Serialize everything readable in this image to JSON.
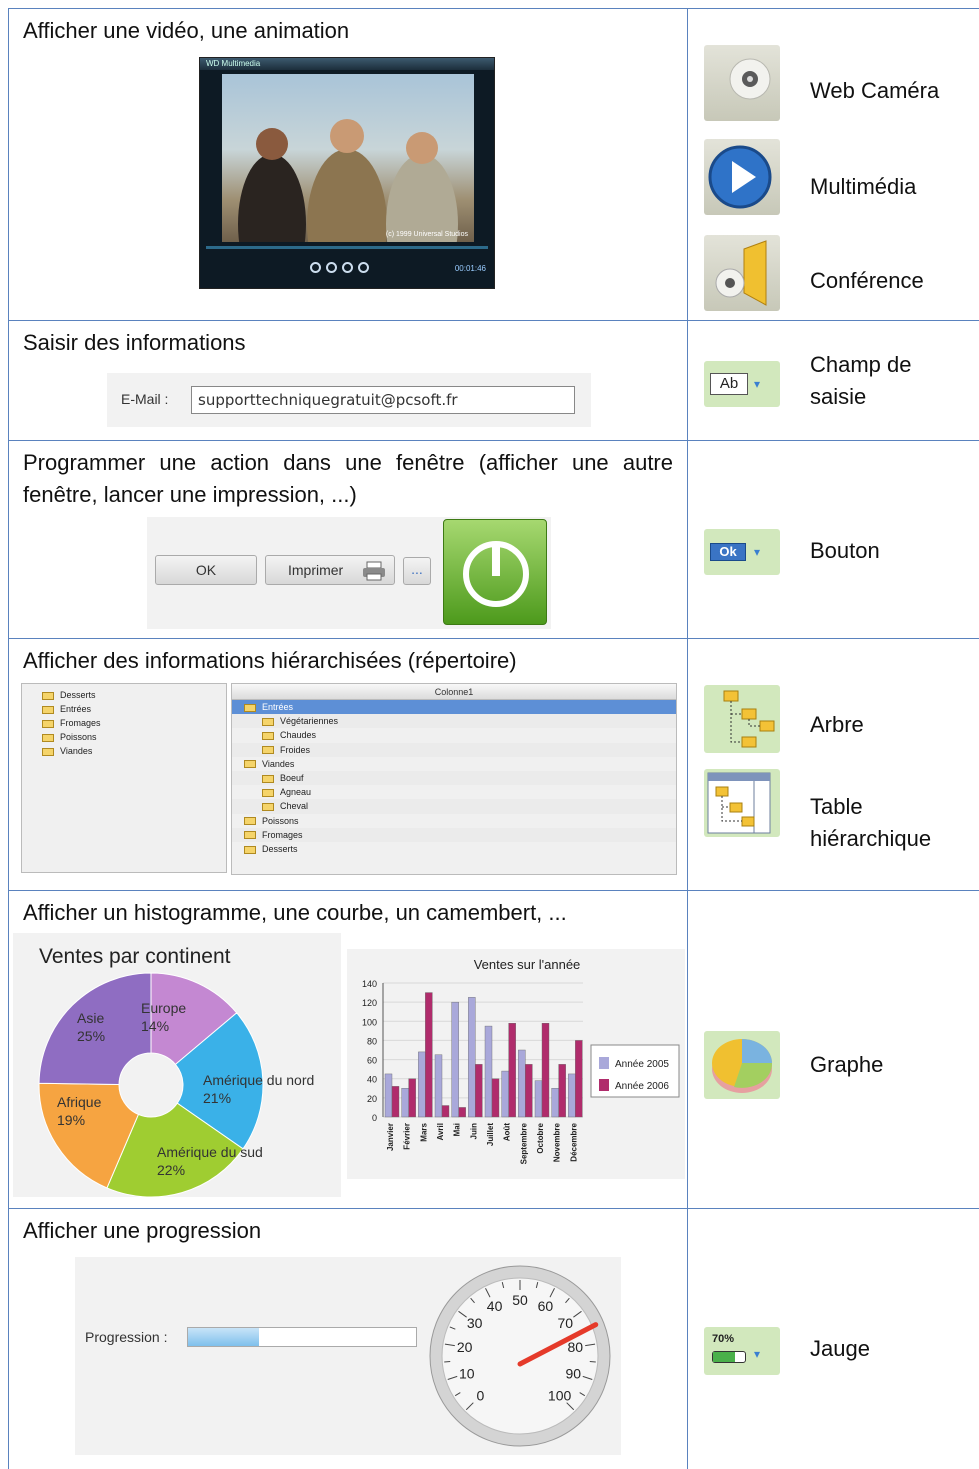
{
  "rows": [
    {
      "title": "Afficher une vidéo, une animation",
      "controls": [
        {
          "label": "Web Caméra",
          "icon": "webcam-icon"
        },
        {
          "label": "Multimédia",
          "icon": "play-icon"
        },
        {
          "label": "Conférence",
          "icon": "speaker-icon"
        }
      ]
    },
    {
      "title": "Saisir des informations",
      "controls": [
        {
          "label_line1": "Champ de",
          "label_line2": "saisie",
          "icon": "edit-field-icon"
        }
      ]
    },
    {
      "title": "Programmer une action dans une fenêtre (afficher une autre fenêtre, lancer une impression, ...)",
      "controls": [
        {
          "label": "Bouton",
          "icon": "button-icon"
        }
      ]
    },
    {
      "title": "Afficher des informations hiérarchisées (répertoire)",
      "controls": [
        {
          "label": "Arbre",
          "icon": "tree-icon"
        },
        {
          "label_line1": "Table",
          "label_line2": "hiérarchique",
          "icon": "tree-table-icon"
        }
      ]
    },
    {
      "title": "Afficher un histogramme, une courbe, un camembert, ...",
      "controls": [
        {
          "label": "Graphe",
          "icon": "chart-icon"
        }
      ]
    },
    {
      "title": "Afficher une progression",
      "controls": [
        {
          "label": "Jauge",
          "icon": "gauge-icon"
        }
      ]
    }
  ],
  "video_player": {
    "window_title": "WD Multimedia",
    "copyright": "(c) 1999 Universal Studios",
    "time": "00:01:46"
  },
  "edit_example": {
    "label": "E-Mail :",
    "value": "supporttechniquegratuit@pcsoft.fr"
  },
  "button_example": {
    "ok": "OK",
    "print": "Imprimer",
    "ellipsis": "..."
  },
  "tree_example": {
    "left_items": [
      "Desserts",
      "Entrées",
      "Fromages",
      "Poissons",
      "Viandes"
    ],
    "column_header": "Colonne1",
    "table_items": [
      {
        "text": "Entrées",
        "level": 0
      },
      {
        "text": "Végétariennes",
        "level": 1
      },
      {
        "text": "Chaudes",
        "level": 1
      },
      {
        "text": "Froides",
        "level": 1
      },
      {
        "text": "Viandes",
        "level": 0
      },
      {
        "text": "Boeuf",
        "level": 1
      },
      {
        "text": "Agneau",
        "level": 1
      },
      {
        "text": "Cheval",
        "level": 1
      },
      {
        "text": "Poissons",
        "level": 0
      },
      {
        "text": "Fromages",
        "level": 0
      },
      {
        "text": "Desserts",
        "level": 0
      }
    ]
  },
  "gauge_example": {
    "label": "Progression :",
    "progress_fraction": 0.31,
    "value": 75,
    "ticks": [
      "0",
      "10",
      "20",
      "30",
      "40",
      "50",
      "60",
      "70",
      "80",
      "90",
      "100"
    ]
  },
  "icon_texts": {
    "edit": "Ab",
    "button": "Ok",
    "gauge": "70%"
  },
  "chart_data": [
    {
      "type": "pie",
      "title": "Ventes par continent",
      "slices": [
        {
          "label": "Europe",
          "value": 14,
          "color": "#c488d2"
        },
        {
          "label": "Amérique du nord",
          "value": 21,
          "color": "#3ab1e8"
        },
        {
          "label": "Amérique du sud",
          "value": 22,
          "color": "#9fcd31"
        },
        {
          "label": "Afrique",
          "value": 19,
          "color": "#f6a441"
        },
        {
          "label": "Asie",
          "value": 25,
          "color": "#8f6dc2"
        }
      ],
      "labels_text": {
        "Europe": "14%",
        "Amérique du nord": "21%",
        "Amérique du sud": "22%",
        "Afrique": "19%",
        "Asie": "25%"
      }
    },
    {
      "type": "bar",
      "title": "Ventes sur l'année",
      "categories": [
        "Janvier",
        "Février",
        "Mars",
        "Avril",
        "Mai",
        "Juin",
        "Juillet",
        "Août",
        "Septembre",
        "Octobre",
        "Novembre",
        "Décembre"
      ],
      "series": [
        {
          "name": "Année 2005",
          "values": [
            45,
            30,
            68,
            65,
            120,
            125,
            95,
            48,
            70,
            38,
            30,
            45
          ],
          "color": "#a9a8da"
        },
        {
          "name": "Année 2006",
          "values": [
            32,
            40,
            130,
            12,
            10,
            55,
            40,
            98,
            55,
            98,
            55,
            80
          ],
          "color": "#b02c6c"
        }
      ],
      "ylim": [
        0,
        140
      ],
      "yticks": [
        0,
        20,
        40,
        60,
        80,
        100,
        120,
        140
      ],
      "legend": "right"
    }
  ]
}
